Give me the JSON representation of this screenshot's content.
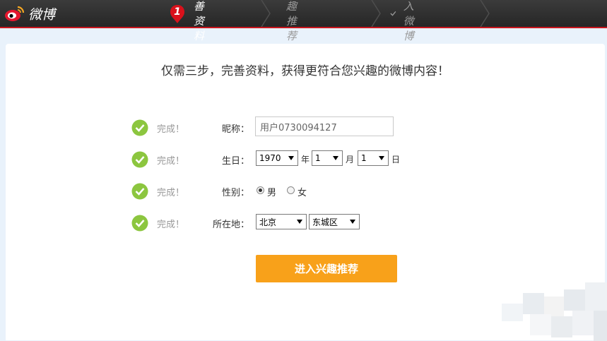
{
  "app": {
    "logo_text": "微博"
  },
  "steps": [
    {
      "label": "完善资料",
      "badge": "1",
      "state": "active"
    },
    {
      "label": "兴趣推荐",
      "state": "pending"
    },
    {
      "label": "进入微博",
      "state": "pending"
    }
  ],
  "headline": "仅需三步，完善资料，获得更符合您兴趣的微博内容！",
  "form": {
    "status_text": "完成！",
    "nickname": {
      "label": "昵称：",
      "value": "用户0730094127"
    },
    "birthday": {
      "label": "生日：",
      "year": "1970",
      "year_unit": "年",
      "month": "1",
      "month_unit": "月",
      "day": "1",
      "day_unit": "日"
    },
    "gender": {
      "label": "性别：",
      "options": [
        {
          "label": "男",
          "checked": true
        },
        {
          "label": "女",
          "checked": false
        }
      ]
    },
    "location": {
      "label": "所在地：",
      "province": "北京",
      "district": "东城区"
    }
  },
  "submit_label": "进入兴趣推荐",
  "colors": {
    "topbar": "#2e2e2e",
    "accent_red": "#c8161d",
    "check_green": "#8cc63f",
    "button_orange": "#f8a11a",
    "page_bg": "#e9f2fb"
  }
}
